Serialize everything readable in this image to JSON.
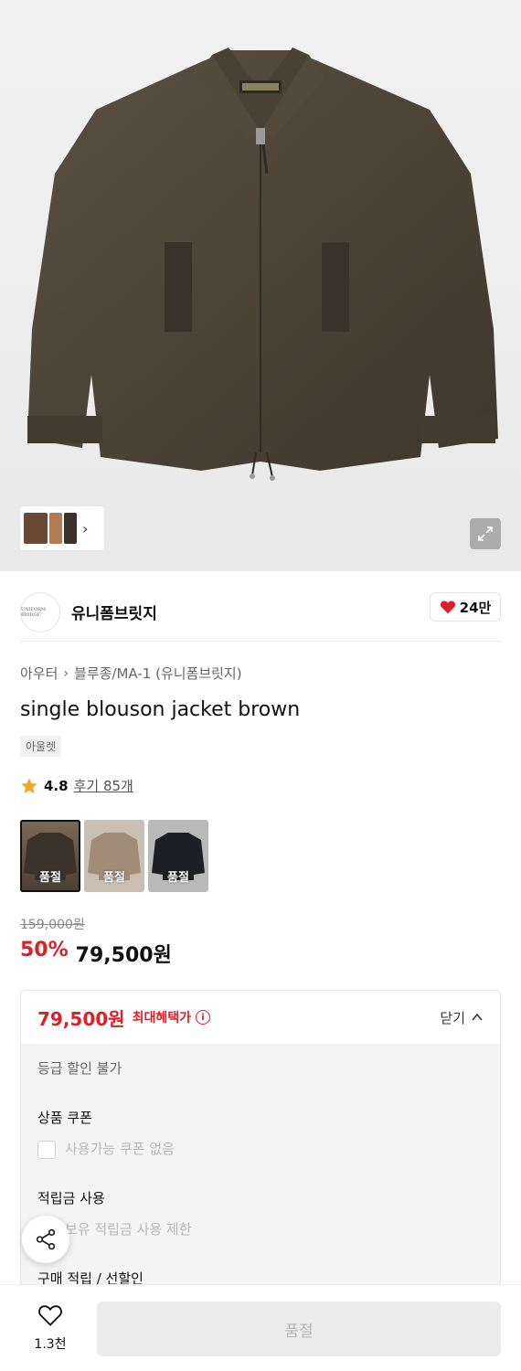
{
  "hero": {
    "image_alt": "single blouson jacket brown",
    "thumb_chevron": "›"
  },
  "brand": {
    "logo_text": "UNIFORM BRIDGE",
    "name": "유니폼브릿지",
    "like_count": "24만"
  },
  "breadcrumb": [
    "아우터",
    "블루종/MA-1 (유니폼브릿지)"
  ],
  "product": {
    "title": "single blouson jacket brown",
    "tag": "아울렛",
    "rating": "4.8",
    "reviews": "후기 85개"
  },
  "colors": [
    {
      "label": "품절",
      "swatch": "#4a3f33"
    },
    {
      "label": "품절",
      "swatch": "#a08c78"
    },
    {
      "label": "품절",
      "swatch": "#1e1f24"
    }
  ],
  "price": {
    "original": "159,000원",
    "discount": "50%",
    "sale": "79,500원"
  },
  "benefit": {
    "price": "79,500원",
    "label": "최대혜택가",
    "close_label": "닫기",
    "grade_discount": "등급 할인 불가",
    "coupon_title": "상품 쿠폰",
    "coupon_placeholder": "사용가능 쿠폰 없음",
    "points_title": "적립금 사용",
    "points_placeholder": "보유 적립금 사용 제한",
    "purchase_title": "구매 적립 / 선할인"
  },
  "bottom": {
    "wish_count": "1.3천",
    "buy_label": "품절"
  },
  "colors_theme": {
    "accent_red": "#e01e26",
    "jacket": "#4b4234"
  }
}
